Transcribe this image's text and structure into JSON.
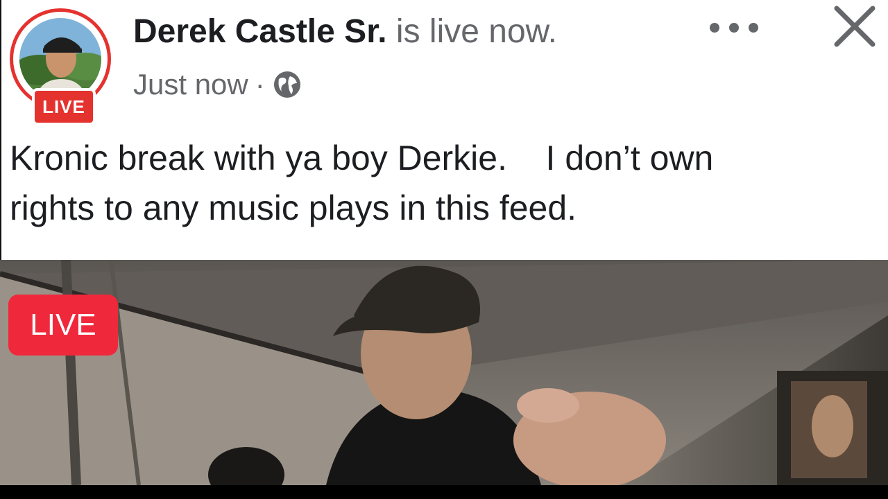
{
  "post": {
    "author": "Derek Castle Sr.",
    "status_text": "is live now.",
    "timestamp": "Just now",
    "separator": "·",
    "audience_icon": "globe-icon",
    "avatar_badge": "LIVE",
    "caption_lines": [
      "Kronic break with ya boy Derkie.    I don’t own",
      "rights to any music plays in this feed."
    ]
  },
  "header_actions": {
    "more_icon": "more-options-icon",
    "close_icon": "close-icon"
  },
  "video": {
    "live_badge": "LIVE"
  },
  "colors": {
    "live_red": "#e4332f",
    "video_live_red": "#f0283c",
    "text_primary": "#1c1e21",
    "text_secondary": "#65676b"
  }
}
